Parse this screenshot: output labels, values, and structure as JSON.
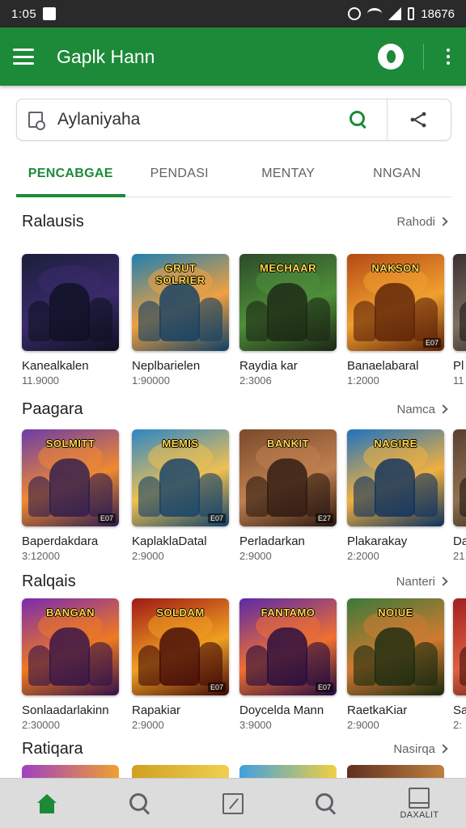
{
  "status_bar": {
    "time": "1:05",
    "battery": "18676"
  },
  "app_bar": {
    "title": "Gaplk Hann"
  },
  "search": {
    "value": "Aylaniyaha"
  },
  "tabs": [
    {
      "label": "PENCABGAE",
      "active": true
    },
    {
      "label": "PENDASI",
      "active": false
    },
    {
      "label": "MENTAY",
      "active": false
    },
    {
      "label": "NNGAN",
      "active": false
    }
  ],
  "sections": [
    {
      "title": "Ralausis",
      "more": "Rahodi",
      "cards": [
        {
          "name": "Kanealkalen",
          "meta": "11.9000",
          "banner": "",
          "badge": "",
          "palette": [
            "#1a1f3a",
            "#3b2a6b",
            "#0d1020"
          ]
        },
        {
          "name": "Neplbarielen",
          "meta": "1:90000",
          "banner": "GRUT SOLRIER",
          "badge": "",
          "palette": [
            "#1f7fb0",
            "#f0a040",
            "#0e3f66"
          ]
        },
        {
          "name": "Raydia kar",
          "meta": "2:3006",
          "banner": "MECHAAR",
          "badge": "",
          "palette": [
            "#2d4a2a",
            "#4f8f3a",
            "#1a2514"
          ]
        },
        {
          "name": "Banaelabaral",
          "meta": "1:2000",
          "banner": "NAKSON",
          "badge": "E07",
          "palette": [
            "#b54a16",
            "#f0a030",
            "#5a2008"
          ]
        },
        {
          "name": "Pl",
          "meta": "11",
          "banner": "",
          "badge": "",
          "palette": [
            "#3a3030",
            "#807060",
            "#201818"
          ]
        }
      ]
    },
    {
      "title": "Paagara",
      "more": "Namca",
      "cards": [
        {
          "name": "Baperdakdara",
          "meta": "3:12000",
          "banner": "SOLMITT",
          "badge": "E07",
          "palette": [
            "#6b3ca8",
            "#f08a30",
            "#2a1a50"
          ]
        },
        {
          "name": "KaplaklaDatal",
          "meta": "2:9000",
          "banner": "MEMIS",
          "badge": "E07",
          "palette": [
            "#2a86c8",
            "#f0c050",
            "#10406a"
          ]
        },
        {
          "name": "Perladarkan",
          "meta": "2:9000",
          "banner": "BANKIT",
          "badge": "E27",
          "palette": [
            "#7a4a2a",
            "#c08050",
            "#2a1810"
          ]
        },
        {
          "name": "Plakarakay",
          "meta": "2:2000",
          "banner": "NAGIRE",
          "badge": "",
          "palette": [
            "#1e72c0",
            "#f0b040",
            "#0a3060"
          ]
        },
        {
          "name": "Da",
          "meta": "21",
          "banner": "",
          "badge": "",
          "palette": [
            "#5a4030",
            "#907050",
            "#201810"
          ]
        }
      ]
    },
    {
      "title": "Ralqais",
      "more": "Nanteri",
      "cards": [
        {
          "name": "Sonlaadarlakinn",
          "meta": "2:30000",
          "banner": "BANGAN",
          "badge": "",
          "palette": [
            "#7a2ab0",
            "#f07a20",
            "#30104a"
          ]
        },
        {
          "name": "Rapakiar",
          "meta": "2:9000",
          "banner": "SOLDAM",
          "badge": "E07",
          "palette": [
            "#a01818",
            "#f0a020",
            "#400808"
          ]
        },
        {
          "name": "Doycelda Mann",
          "meta": "3:9000",
          "banner": "FANTAMO",
          "badge": "E07",
          "palette": [
            "#5a2aa8",
            "#f07030",
            "#200a40"
          ]
        },
        {
          "name": "RaetkaKiar",
          "meta": "2:9000",
          "banner": "NOIUE",
          "badge": "",
          "palette": [
            "#3a7a3a",
            "#d07a30",
            "#182a10"
          ]
        },
        {
          "name": "Sa",
          "meta": "2:",
          "banner": "",
          "badge": "",
          "palette": [
            "#a02020",
            "#e06040",
            "#401010"
          ]
        }
      ]
    },
    {
      "title": "Ratiqara",
      "more": "Nasirqa",
      "cards": []
    }
  ],
  "bottom_nav": [
    {
      "name": "home",
      "label": ""
    },
    {
      "name": "search",
      "label": ""
    },
    {
      "name": "edit",
      "label": ""
    },
    {
      "name": "search-2",
      "label": ""
    },
    {
      "name": "library",
      "label": "DAXALIT"
    }
  ]
}
